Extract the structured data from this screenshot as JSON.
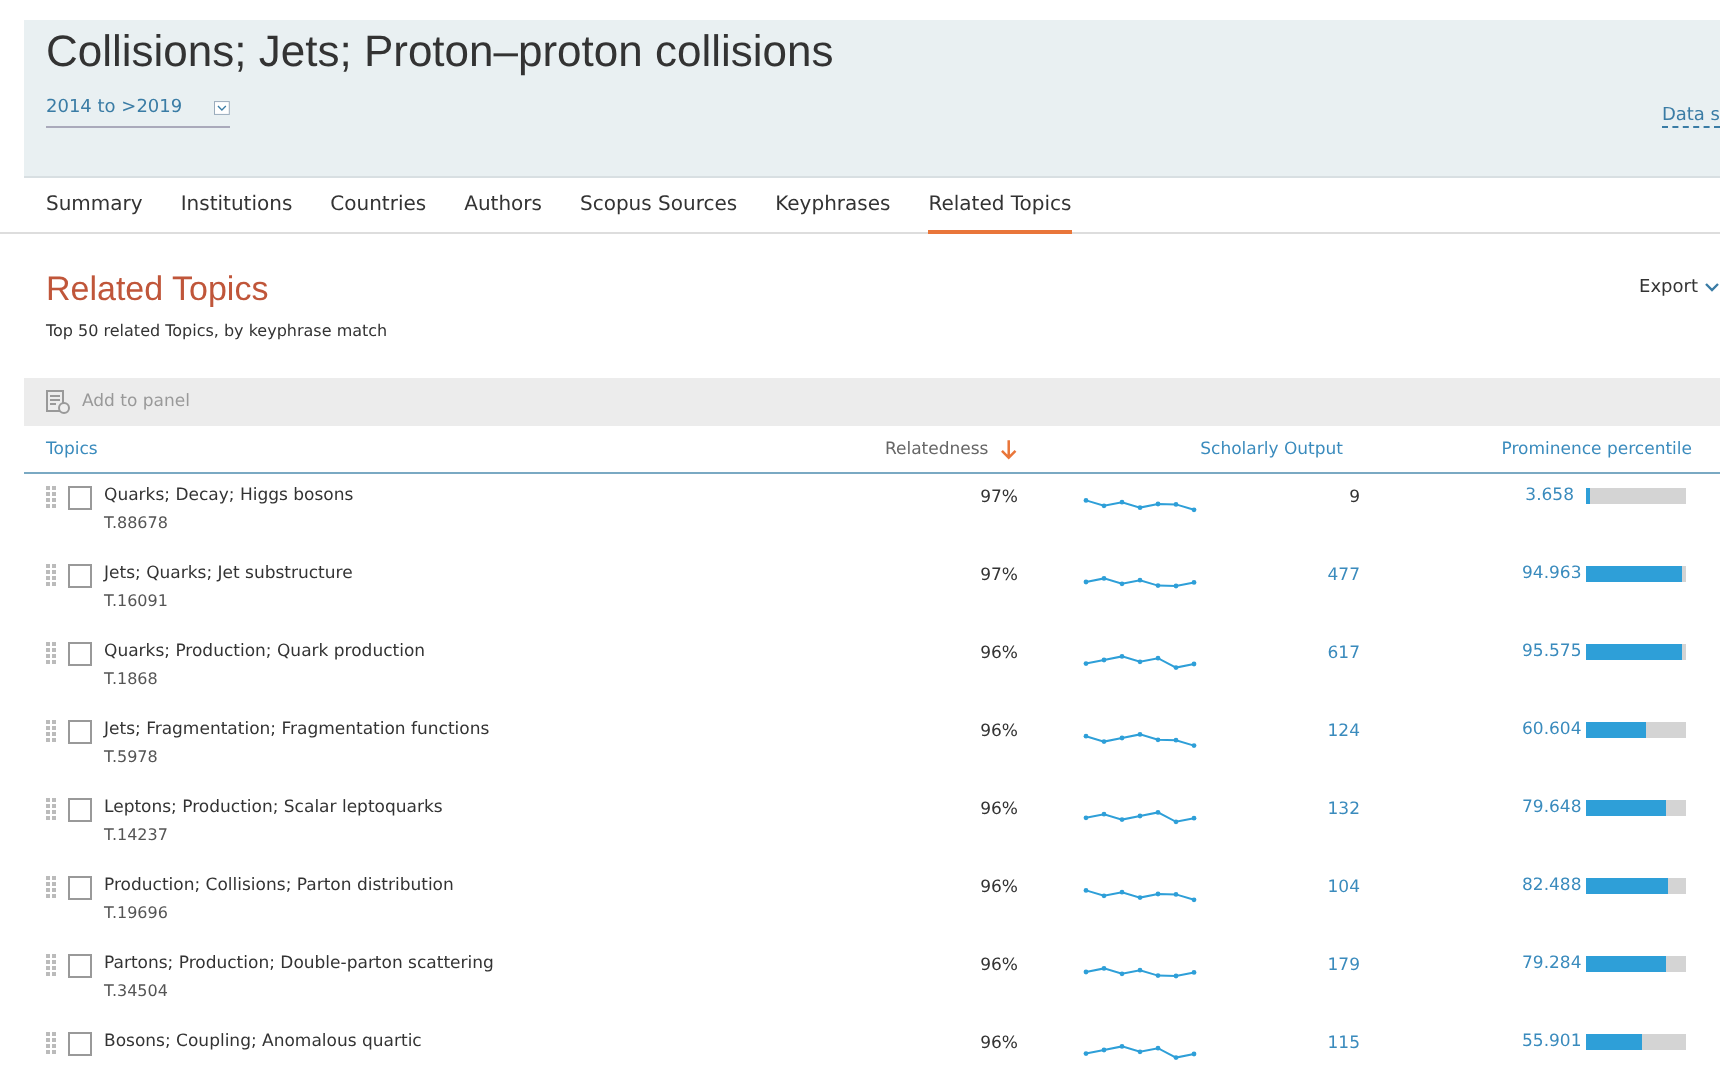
{
  "header": {
    "title": "Collisions; Jets; Proton–proton collisions",
    "date_range": "2014 to >2019",
    "data_link": "Data s"
  },
  "tabs": [
    {
      "label": "Summary",
      "selected": false
    },
    {
      "label": "Institutions",
      "selected": false
    },
    {
      "label": "Countries",
      "selected": false
    },
    {
      "label": "Authors",
      "selected": false
    },
    {
      "label": "Scopus Sources",
      "selected": false
    },
    {
      "label": "Keyphrases",
      "selected": false
    },
    {
      "label": "Related Topics",
      "selected": true
    }
  ],
  "section": {
    "title": "Related Topics",
    "subtitle": "Top 50 related Topics, by keyphrase match",
    "export": "Export"
  },
  "toolbar": {
    "add_to_panel": "Add to panel"
  },
  "table": {
    "columns": [
      "Topics",
      "Relatedness",
      "Scholarly Output",
      "Prominence percentile"
    ],
    "rows": [
      {
        "topic": "Quarks; Decay; Higgs bosons",
        "code": "T.88678",
        "relatedness": "97%",
        "output": "9",
        "output_link": false,
        "prominence": "3.658",
        "level": 0.037,
        "checked": false
      },
      {
        "topic": "Jets; Quarks; Jet substructure",
        "code": "T.16091",
        "relatedness": "97%",
        "output": "477",
        "output_link": true,
        "prominence": "94.963",
        "level": 0.95,
        "checked": false
      },
      {
        "topic": "Quarks; Production; Quark production",
        "code": "T.1868",
        "relatedness": "96%",
        "output": "617",
        "output_link": true,
        "prominence": "95.575",
        "level": 0.956,
        "checked": false
      },
      {
        "topic": "Jets; Fragmentation; Fragmentation functions",
        "code": "T.5978",
        "relatedness": "96%",
        "output": "124",
        "output_link": true,
        "prominence": "60.604",
        "level": 0.606,
        "checked": false
      },
      {
        "topic": "Leptons; Production; Scalar leptoquarks",
        "code": "T.14237",
        "relatedness": "96%",
        "output": "132",
        "output_link": true,
        "prominence": "79.648",
        "level": 0.796,
        "checked": false
      },
      {
        "topic": "Production; Collisions; Parton distribution",
        "code": "T.19696",
        "relatedness": "96%",
        "output": "104",
        "output_link": true,
        "prominence": "82.488",
        "level": 0.825,
        "checked": false
      },
      {
        "topic": "Partons; Production; Double-parton scattering",
        "code": "T.34504",
        "relatedness": "96%",
        "output": "179",
        "output_link": true,
        "prominence": "79.284",
        "level": 0.793,
        "checked": false
      },
      {
        "topic": "Bosons; Coupling; Anomalous quartic",
        "relatedness": "96%",
        "output": "115",
        "output_link": true,
        "prominence": "55.901",
        "level": 0.559,
        "checked": false
      }
    ]
  }
}
